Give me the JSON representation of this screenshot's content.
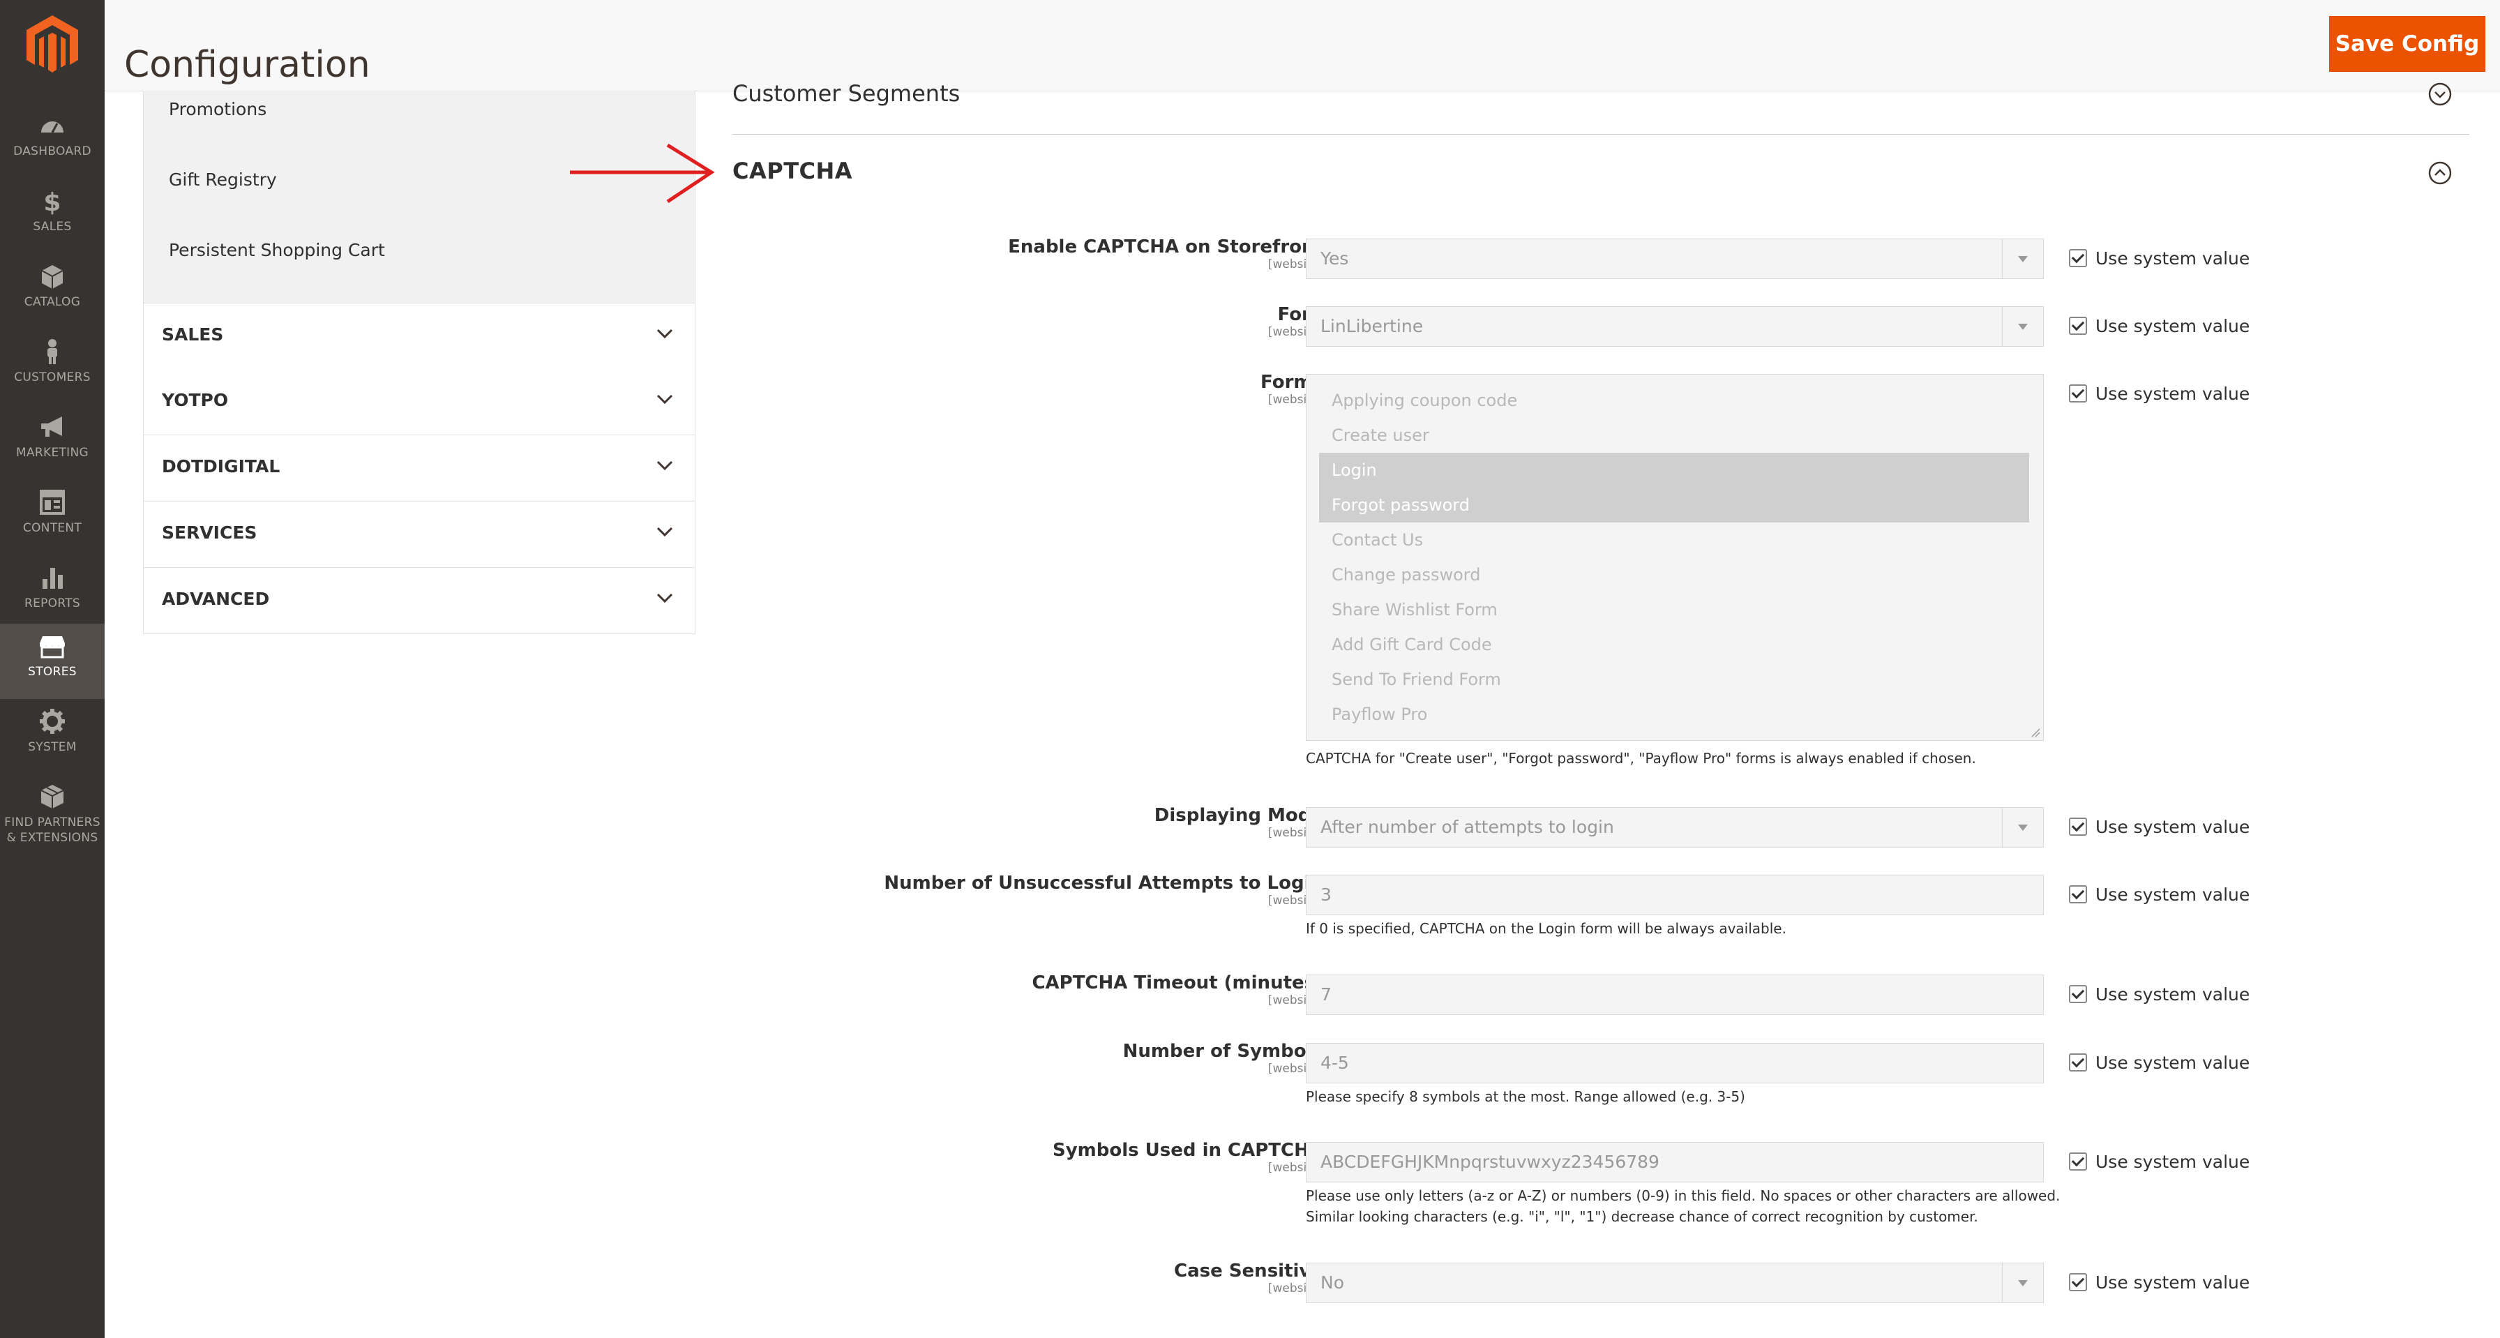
{
  "nav": [
    {
      "label": "DASHBOARD",
      "icon": "dashboard-icon"
    },
    {
      "label": "SALES",
      "icon": "dollar-icon"
    },
    {
      "label": "CATALOG",
      "icon": "cube-icon"
    },
    {
      "label": "CUSTOMERS",
      "icon": "person-icon"
    },
    {
      "label": "MARKETING",
      "icon": "megaphone-icon"
    },
    {
      "label": "CONTENT",
      "icon": "layout-icon"
    },
    {
      "label": "REPORTS",
      "icon": "bar-chart-icon"
    },
    {
      "label": "STORES",
      "icon": "storefront-icon"
    },
    {
      "label": "SYSTEM",
      "icon": "gear-icon"
    },
    {
      "label": "FIND PARTNERS",
      "label2": "& EXTENSIONS",
      "icon": "box-icon"
    }
  ],
  "header": {
    "title": "Configuration",
    "save_label": "Save Config"
  },
  "left_panel": {
    "sub_links": [
      "Promotions",
      "Gift Registry",
      "Persistent Shopping Cart"
    ],
    "groups": [
      "SALES",
      "YOTPO",
      "DOTDIGITAL",
      "SERVICES",
      "ADVANCED"
    ]
  },
  "main": {
    "prev_section": "Customer Segments",
    "section": "CAPTCHA",
    "system_value_label": "Use system value",
    "scope": "[website]",
    "fields": {
      "enable": {
        "label": "Enable CAPTCHA on Storefront",
        "value": "Yes"
      },
      "font": {
        "label": "Font",
        "value": "LinLibertine"
      },
      "forms": {
        "label": "Forms",
        "options": [
          "Applying coupon code",
          "Create user",
          "Login",
          "Forgot password",
          "Contact Us",
          "Change password",
          "Share Wishlist Form",
          "Add Gift Card Code",
          "Send To Friend Form",
          "Payflow Pro"
        ],
        "selected": [
          "Login",
          "Forgot password"
        ],
        "note": "CAPTCHA for \"Create user\", \"Forgot password\", \"Payflow Pro\" forms is always enabled if chosen."
      },
      "mode": {
        "label": "Displaying Mode",
        "value": "After number of attempts to login"
      },
      "attempts": {
        "label": "Number of Unsuccessful Attempts to Login",
        "value": "3",
        "note": "If 0 is specified, CAPTCHA on the Login form will be always available."
      },
      "timeout": {
        "label": "CAPTCHA Timeout (minutes)",
        "value": "7"
      },
      "symbols_count": {
        "label": "Number of Symbols",
        "value": "4-5",
        "note": "Please specify 8 symbols at the most. Range allowed (e.g. 3-5)"
      },
      "symbols": {
        "label": "Symbols Used in CAPTCHA",
        "value": "ABCDEFGHJKMnpqrstuvwxyz23456789",
        "note1": "Please use only letters (a-z or A-Z) or numbers (0-9) in this field. No spaces or other characters are allowed.",
        "note2": "Similar looking characters (e.g. \"i\", \"l\", \"1\") decrease chance of correct recognition by customer."
      },
      "case": {
        "label": "Case Sensitive",
        "value": "No"
      }
    }
  }
}
